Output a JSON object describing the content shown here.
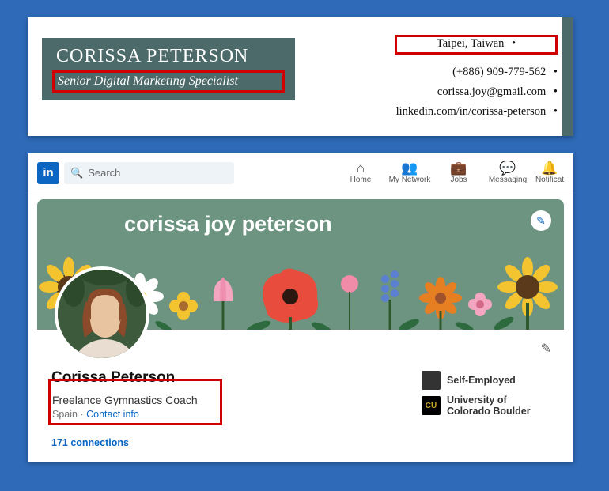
{
  "resume": {
    "name": "CORISSA PETERSON",
    "title": "Senior Digital Marketing Specialist",
    "location": "Taipei, Taiwan",
    "phone": "(+886) 909-779-562",
    "email": "corissa.joy@gmail.com",
    "linkedin": "linkedin.com/in/corissa-peterson"
  },
  "linkedin": {
    "logo": "in",
    "search_placeholder": "Search",
    "nav": {
      "home": "Home",
      "network": "My Network",
      "jobs": "Jobs",
      "messaging": "Messaging",
      "notifications": "Notificat"
    },
    "banner_name": "corissa joy peterson",
    "profile": {
      "name": "Corissa Peterson",
      "headline": "Freelance Gymnastics Coach",
      "location": "Spain",
      "contact_info": "Contact info",
      "connections": "171 connections",
      "employer": "Self-Employed",
      "education": "University of Colorado Boulder"
    }
  }
}
